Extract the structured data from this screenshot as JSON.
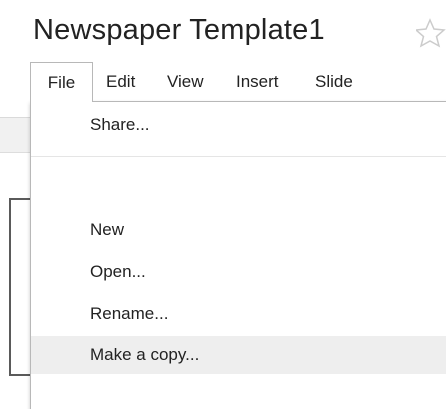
{
  "document": {
    "title": "Newspaper Template1",
    "star_icon": "star-icon"
  },
  "menubar": {
    "items": [
      {
        "label": "File",
        "active": true
      },
      {
        "label": "Edit"
      },
      {
        "label": "View"
      },
      {
        "label": "Insert"
      },
      {
        "label": "Slide"
      }
    ]
  },
  "file_menu": {
    "items": [
      {
        "label": "Share..."
      },
      {
        "label": "New"
      },
      {
        "label": "Open..."
      },
      {
        "label": "Rename..."
      },
      {
        "label": "Make a copy...",
        "highlighted": true
      }
    ]
  },
  "colors": {
    "text": "#222222",
    "highlight": "#eeeeee",
    "border": "#b8b8b8",
    "star": "#cccccc"
  }
}
